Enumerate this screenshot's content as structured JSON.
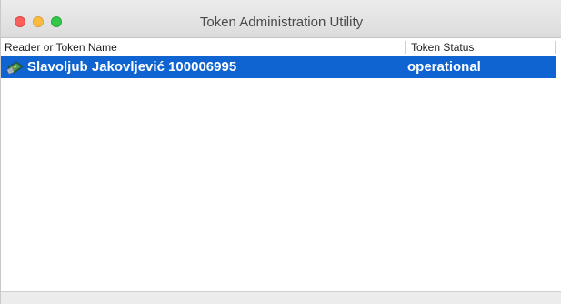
{
  "window": {
    "title": "Token Administration Utility"
  },
  "table": {
    "columns": [
      "Reader or Token Name",
      "Token Status"
    ],
    "rows": [
      {
        "icon": "smart-card-token-icon",
        "name": "Slavoljub Jakovljević 100006995",
        "status": "operational",
        "selected": true
      }
    ]
  },
  "colors": {
    "selection": "#0f64d2",
    "selection_text": "#ffffff",
    "close": "#fc605c",
    "minimize": "#fdbc40",
    "zoom": "#34c84a"
  }
}
